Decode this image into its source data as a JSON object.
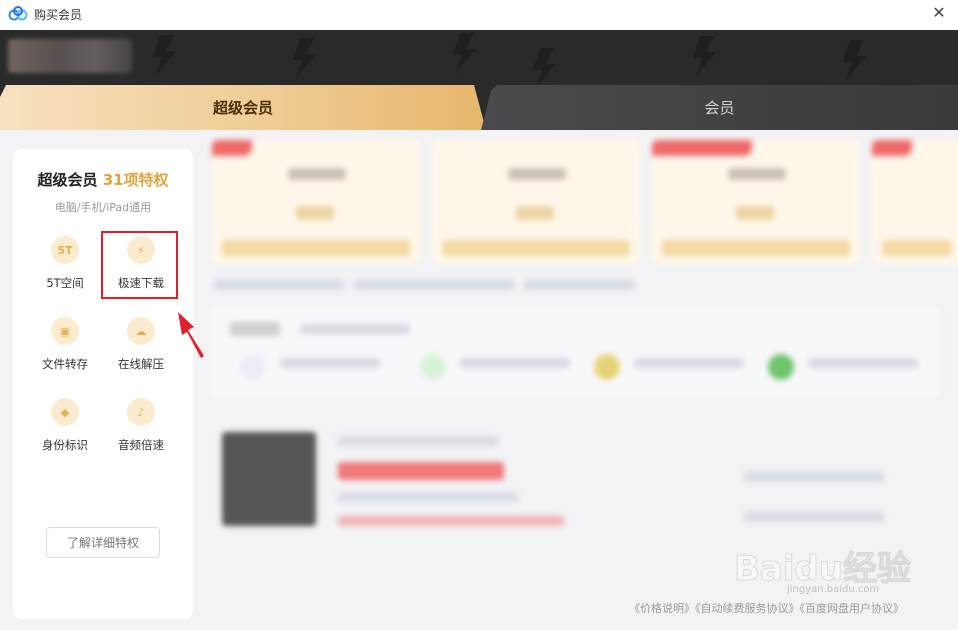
{
  "window": {
    "title": "购买会员",
    "close_glyph": "✕"
  },
  "tabs": [
    {
      "label": "超级会员",
      "active": true
    },
    {
      "label": "会员",
      "active": false
    }
  ],
  "left_card": {
    "title_main": "超级会员",
    "title_accent": "31项特权",
    "subtitle": "电脑/手机/iPad通用",
    "privileges": [
      {
        "label": "5T空间",
        "icon": "storage-5t-icon",
        "glyph": "5T"
      },
      {
        "label": "极速下载",
        "icon": "lightning-icon",
        "glyph": "⚡"
      },
      {
        "label": "文件转存",
        "icon": "file-transfer-icon",
        "glyph": "▣"
      },
      {
        "label": "在线解压",
        "icon": "cloud-unzip-icon",
        "glyph": "☁"
      },
      {
        "label": "身份标识",
        "icon": "diamond-badge-icon",
        "glyph": "◆"
      },
      {
        "label": "音频倍速",
        "icon": "audio-speed-icon",
        "glyph": "♪"
      }
    ],
    "detail_button": "了解详细特权"
  },
  "footer": {
    "price_note": "《价格说明》",
    "auto_renew": "《自动续费服务协议》",
    "user_agreement": "《百度网盘用户协议》"
  },
  "watermark": {
    "text": "Baidu经验",
    "sub": "jingyan.baidu.com"
  },
  "colors": {
    "accent_gold": "#e3a23c",
    "highlight_red": "#e0202a",
    "header_dark": "#2a2a2b"
  }
}
